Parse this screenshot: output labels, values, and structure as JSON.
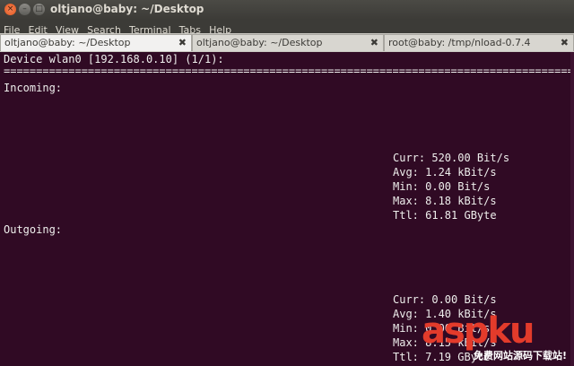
{
  "window": {
    "title": "oltjano@baby: ~/Desktop",
    "buttons": {
      "close": "×",
      "minimize": "–",
      "maximize": "□"
    }
  },
  "menubar": {
    "items": [
      "File",
      "Edit",
      "View",
      "Search",
      "Terminal",
      "Tabs",
      "Help"
    ]
  },
  "tabs": [
    {
      "label": "oltjano@baby: ~/Desktop",
      "close": "✖",
      "active": true
    },
    {
      "label": "oltjano@baby: ~/Desktop",
      "close": "✖",
      "active": false
    },
    {
      "label": "root@baby: /tmp/nload-0.7.4",
      "close": "✖",
      "active": false
    }
  ],
  "terminal": {
    "device_line": "Device wlan0 [192.168.0.10] (1/1):",
    "separator": "================================================================================================",
    "incoming": {
      "heading": "Incoming:",
      "curr": "Curr: 520.00 Bit/s",
      "avg": "Avg: 1.24 kBit/s",
      "min": "Min: 0.00 Bit/s",
      "max": "Max: 8.18 kBit/s",
      "ttl": "Ttl: 61.81 GByte"
    },
    "outgoing": {
      "heading": "Outgoing:",
      "curr": "Curr: 0.00 Bit/s",
      "avg": "Avg: 1.40 kBit/s",
      "min": "Min: 0.00 Bit/s",
      "max": "Max: 8.15 kBit/s",
      "ttl": "Ttl: 7.19 GByte"
    }
  },
  "watermark": {
    "logo": "aspku",
    "tagline": "免费网站源码下载站!"
  }
}
